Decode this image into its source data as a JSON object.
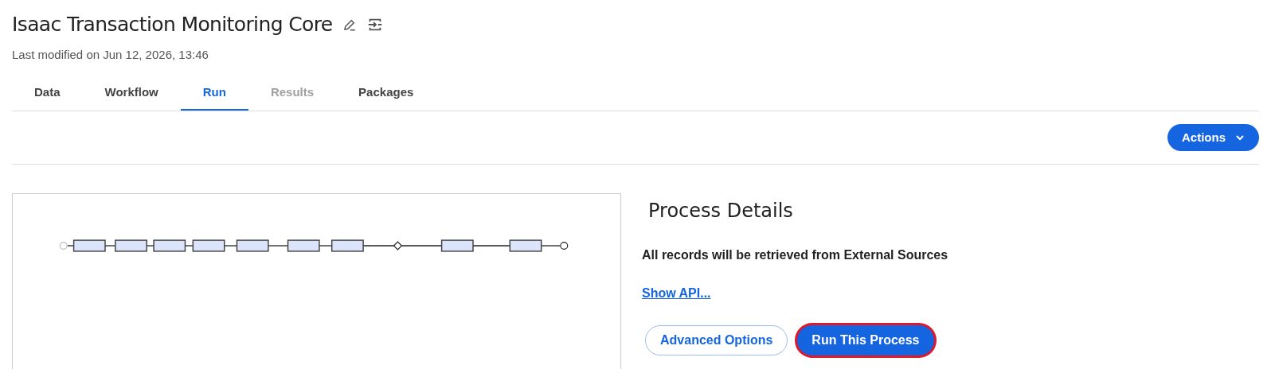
{
  "header": {
    "title": "Isaac Transaction Monitoring Core",
    "subtitle": "Last modified on Jun 12, 2026, 13:46"
  },
  "tabs": [
    {
      "label": "Data",
      "selected": false,
      "disabled": false
    },
    {
      "label": "Workflow",
      "selected": false,
      "disabled": false
    },
    {
      "label": "Run",
      "selected": true,
      "disabled": false
    },
    {
      "label": "Results",
      "selected": false,
      "disabled": true
    },
    {
      "label": "Packages",
      "selected": false,
      "disabled": false
    }
  ],
  "toolbar": {
    "actions_label": "Actions"
  },
  "details": {
    "heading": "Process Details",
    "description": "All records will be retrieved from External Sources",
    "api_link": "Show API...",
    "buttons": [
      {
        "label": "Advanced Options",
        "kind": "secondary",
        "focused": false
      },
      {
        "label": "Run This Process",
        "kind": "primary",
        "focused": true
      }
    ]
  }
}
